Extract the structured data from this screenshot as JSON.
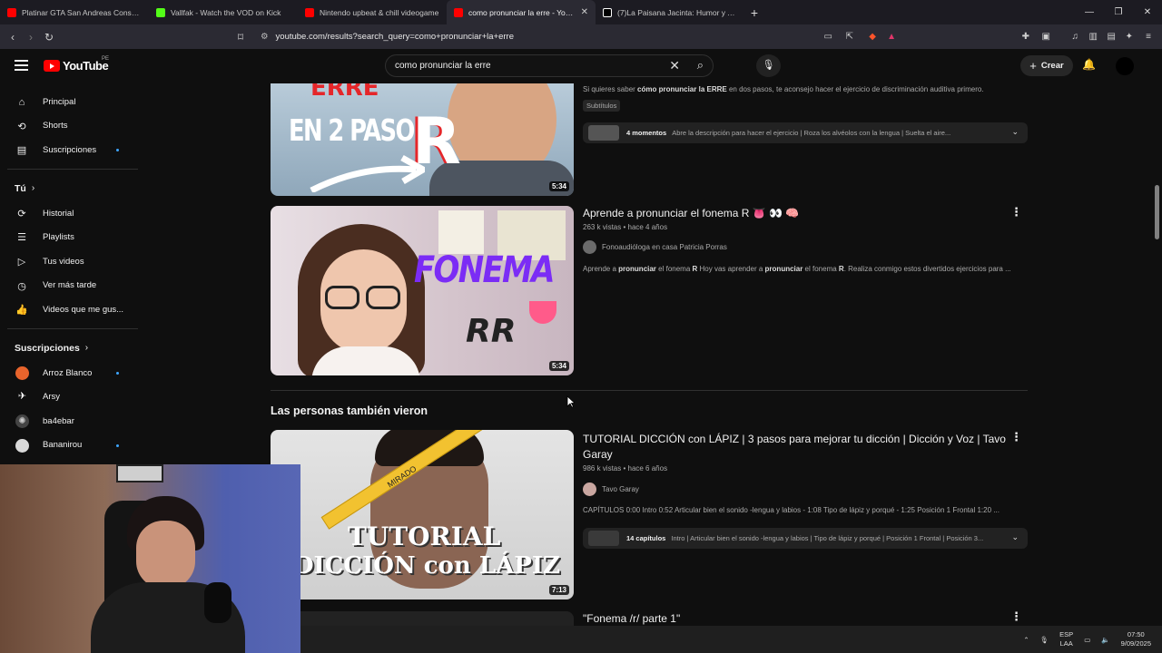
{
  "browser": {
    "tabs": [
      {
        "label": "Platinar GTA San Andreas Consumió",
        "color": "#ff0000",
        "active": false
      },
      {
        "label": "Vallfak - Watch the VOD on Kick",
        "color": "#53fc18",
        "active": false
      },
      {
        "label": "Nintendo upbeat & chill videogame",
        "color": "#ff0000",
        "active": false
      },
      {
        "label": "como pronunciar la erre - YouTu",
        "color": "#ff0000",
        "active": true
      },
      {
        "label": "(7)La Paisana Jacinta: Humor y Avent",
        "color": "#ffffff",
        "active": false
      }
    ],
    "url": "youtube.com/results?search_query=como+pronunciar+la+erre"
  },
  "youtube": {
    "logo_text": "YouTube",
    "logo_region": "PE",
    "search_value": "como pronunciar la erre",
    "create_label": "Crear"
  },
  "sidebar": {
    "main": [
      {
        "label": "Principal",
        "icon": "home-icon"
      },
      {
        "label": "Shorts",
        "icon": "shorts-icon"
      },
      {
        "label": "Suscripciones",
        "icon": "subscriptions-icon"
      }
    ],
    "you_label": "Tú",
    "you_items": [
      {
        "label": "Historial",
        "icon": "history-icon"
      },
      {
        "label": "Playlists",
        "icon": "playlists-icon"
      },
      {
        "label": "Tus videos",
        "icon": "your-videos-icon"
      },
      {
        "label": "Ver más tarde",
        "icon": "watch-later-icon"
      },
      {
        "label": "Videos que me gus...",
        "icon": "liked-videos-icon"
      }
    ],
    "subs_label": "Suscripciones",
    "subs": [
      {
        "label": "Arroz Blanco",
        "color": "#e8642c"
      },
      {
        "label": "Arsy",
        "color": "#ffffff"
      },
      {
        "label": "ba4ebar",
        "color": "#9aa0a6"
      },
      {
        "label": "Bananirou",
        "color": "#d9d9d9"
      }
    ]
  },
  "results": {
    "video1": {
      "thumb_line1": "ERRE",
      "thumb_line2": "EN 2 PASOS",
      "thumb_letter": "R",
      "duration": "5:34",
      "desc_pre": "Si quieres saber ",
      "desc_bold": "cómo pronunciar la ERRE",
      "desc_post": " en dos pasos, te aconsejo hacer el ejercicio de discriminación auditiva primero.",
      "chip": "Subtítulos",
      "moments_count": "4 momentos",
      "moments_text": "Abre la descripción para hacer el ejercicio | Roza los alvéolos con la lengua | Suelta el aire..."
    },
    "video2": {
      "title": "Aprende a pronunciar el fonema R 👅 👀 🧠",
      "meta": "263 k vistas • hace 4 años",
      "channel": "Fonoaudióloga en casa Patricia Porras",
      "thumb_line1": "FONEMA",
      "thumb_line2": "RR",
      "duration": "5:34",
      "desc_a": "Aprende a ",
      "desc_b": "pronunciar",
      "desc_c": " el fonema ",
      "desc_d": "R",
      "desc_e": " Hoy vas aprender a ",
      "desc_f": "pronunciar",
      "desc_g": " el fonema ",
      "desc_h": "R",
      "desc_i": ". Realiza conmigo estos divertidos ejercicios para ..."
    },
    "section_title": "Las personas también vieron",
    "video3": {
      "title": "TUTORIAL DICCIÓN con LÁPIZ | 3 pasos para mejorar tu dicción | Dicción y Voz | Tavo Garay",
      "meta": "986 k vistas • hace 6 años",
      "channel": "Tavo Garay",
      "thumb_line1": "TUTORIAL",
      "thumb_line2": "DICCIÓN con LÁPIZ",
      "pencil_text": "MIRADO",
      "duration": "7:13",
      "desc": "CAPÍTULOS 0:00 Intro 0:52 Articular bien el sonido -lengua y labios - 1:08 Tipo de lápiz y porqué - 1:25 Posición 1 Frontal 1:20 ...",
      "chapters_count": "14 capítulos",
      "chapters_text": "Intro | Articular bien el sonido -lengua y labios | Tipo de lápiz y porqué | Posición 1 Frontal | Posición 3..."
    },
    "video4": {
      "title": "\"Fonema /r/ parte 1\""
    }
  },
  "taskbar": {
    "lang_top": "ESP",
    "lang_bottom": "LAA",
    "time": "07:50",
    "date": "9/09/2025"
  }
}
